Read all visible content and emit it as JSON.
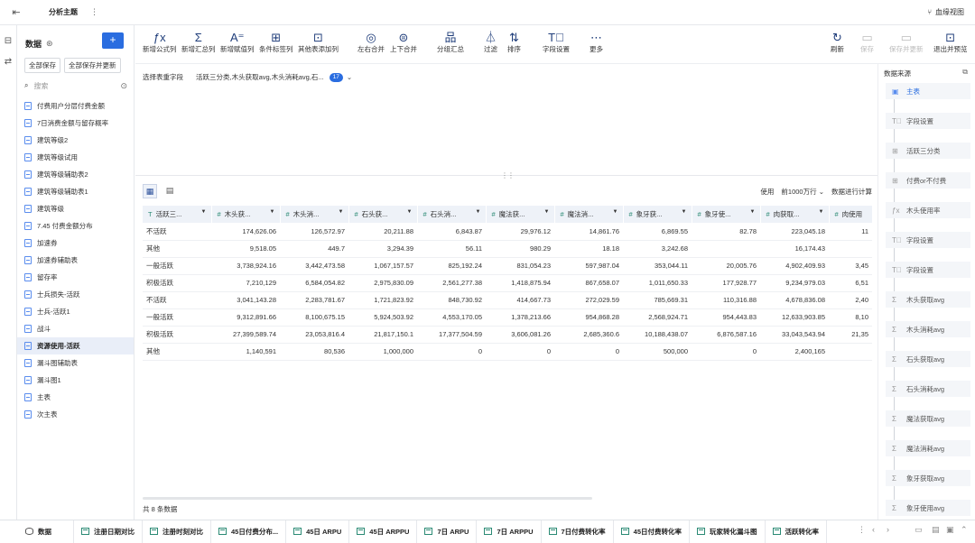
{
  "topbar": {
    "back_icon": "exit-icon",
    "title": "分析主题",
    "more": "⋮",
    "right_label": "血缘视图"
  },
  "sidebar": {
    "title": "数据",
    "add": "+",
    "save_all": "全部保存",
    "save_all_update": "全部保存并更新",
    "search_placeholder": "搜索",
    "items": [
      "付费用户分层付费金额",
      "7日消费金额与留存概率",
      "建筑等级2",
      "建筑等级试用",
      "建筑等级辅助表2",
      "建筑等级辅助表1",
      "建筑等级",
      "7.45 付费金额分布",
      "加速券",
      "加速券辅助表",
      "留存率",
      "士兵损失-活跃",
      "士兵-活跃1",
      "战斗",
      "资源使用-活跃",
      "漏斗图辅助表",
      "漏斗图1",
      "主表",
      "次主表"
    ],
    "active_index": 14
  },
  "toolbar": {
    "items": [
      {
        "g": "ƒx",
        "label": "新增公式列"
      },
      {
        "g": "Σ",
        "label": "新增汇总列"
      },
      {
        "g": "A⁼",
        "label": "新增赋值列"
      },
      {
        "g": "⊞",
        "label": "条件标签列"
      },
      {
        "g": "⊡",
        "label": "其他表添加列"
      },
      {
        "g": "◎",
        "label": "左右合并"
      },
      {
        "g": "⊜",
        "label": "上下合并"
      },
      {
        "g": "品",
        "label": "分组汇总"
      },
      {
        "g": "⏃",
        "label": "过滤"
      },
      {
        "g": "⇅",
        "label": "排序"
      },
      {
        "g": "T⃝",
        "label": "字段设置"
      },
      {
        "g": "⋯",
        "label": "更多"
      }
    ],
    "right": [
      {
        "g": "↻",
        "label": "刷新",
        "dim": false
      },
      {
        "g": "▭",
        "label": "保存",
        "dim": true
      },
      {
        "g": "▭",
        "label": "保存并更新",
        "dim": true
      },
      {
        "g": "⊡",
        "label": "退出并预览",
        "dim": false
      }
    ]
  },
  "select": {
    "label": "选择表重字段",
    "value": "活跃三分类,木头获取avg,木头消耗avg,石...",
    "badge": "17"
  },
  "viewbar": {
    "use": "使用",
    "rows": "前1000万行",
    "action": "数据进行计算"
  },
  "table": {
    "columns": [
      "活跃三...",
      "木头获...",
      "木头消...",
      "石头获...",
      "石头消...",
      "魔法获...",
      "魔法消...",
      "象牙获...",
      "象牙使...",
      "肉获取...",
      "肉使用"
    ],
    "rows": [
      [
        "不活跃",
        "174,626.06",
        "126,572.97",
        "20,211.88",
        "6,843.87",
        "29,976.12",
        "14,861.76",
        "6,869.55",
        "82.78",
        "223,045.18",
        "11"
      ],
      [
        "其他",
        "9,518.05",
        "449.7",
        "3,294.39",
        "56.11",
        "980.29",
        "18.18",
        "3,242.68",
        "",
        "16,174.43",
        ""
      ],
      [
        "一般活跃",
        "3,738,924.16",
        "3,442,473.58",
        "1,067,157.57",
        "825,192.24",
        "831,054.23",
        "597,987.04",
        "353,044.11",
        "20,005.76",
        "4,902,409.93",
        "3,45"
      ],
      [
        "积极活跃",
        "7,210,129",
        "6,584,054.82",
        "2,975,830.09",
        "2,561,277.38",
        "1,418,875.94",
        "867,658.07",
        "1,011,650.33",
        "177,928.77",
        "9,234,979.03",
        "6,51"
      ],
      [
        "不活跃",
        "3,041,143.28",
        "2,283,781.67",
        "1,721,823.92",
        "848,730.92",
        "414,667.73",
        "272,029.59",
        "785,669.31",
        "110,316.88",
        "4,678,836.08",
        "2,40"
      ],
      [
        "一般活跃",
        "9,312,891.66",
        "8,100,675.15",
        "5,924,503.92",
        "4,553,170.05",
        "1,378,213.66",
        "954,868.28",
        "2,568,924.71",
        "954,443.83",
        "12,633,903.85",
        "8,10"
      ],
      [
        "积极活跃",
        "27,399,589.74",
        "23,053,816.4",
        "21,817,150.1",
        "17,377,504.59",
        "3,606,081.26",
        "2,685,360.6",
        "10,188,438.07",
        "6,876,587.16",
        "33,043,543.94",
        "21,35"
      ],
      [
        "其他",
        "1,140,591",
        "80,536",
        "1,000,000",
        "0",
        "0",
        "0",
        "500,000",
        "0",
        "2,400,165",
        ""
      ]
    ],
    "count": "共 8 条数据"
  },
  "rpanel": {
    "title": "数据来源",
    "nodes": [
      {
        "g": "▣",
        "label": "主表"
      },
      {
        "g": "T⃝",
        "label": "字段设置"
      },
      {
        "g": "⊞",
        "label": "活跃三分类"
      },
      {
        "g": "⊞",
        "label": "付费or不付费"
      },
      {
        "g": "ƒx",
        "label": "木头使用率"
      },
      {
        "g": "T⃝",
        "label": "字段设置"
      },
      {
        "g": "T⃝",
        "label": "字段设置"
      },
      {
        "g": "Σ",
        "label": "木头获取avg"
      },
      {
        "g": "Σ",
        "label": "木头消耗avg"
      },
      {
        "g": "Σ",
        "label": "石头获取avg"
      },
      {
        "g": "Σ",
        "label": "石头消耗avg"
      },
      {
        "g": "Σ",
        "label": "魔法获取avg"
      },
      {
        "g": "Σ",
        "label": "魔法消耗avg"
      },
      {
        "g": "Σ",
        "label": "象牙获取avg"
      },
      {
        "g": "Σ",
        "label": "象牙使用avg"
      }
    ]
  },
  "bottom": {
    "tabs": [
      "数据",
      "注册日期对比",
      "注册时刻对比",
      "45日付费分布...",
      "45日 ARPU",
      "45日 ARPPU",
      "7日 ARPU",
      "7日 ARPPU",
      "7日付费转化率",
      "45日付费转化率",
      "玩家转化漏斗图",
      "活跃转化率"
    ]
  }
}
